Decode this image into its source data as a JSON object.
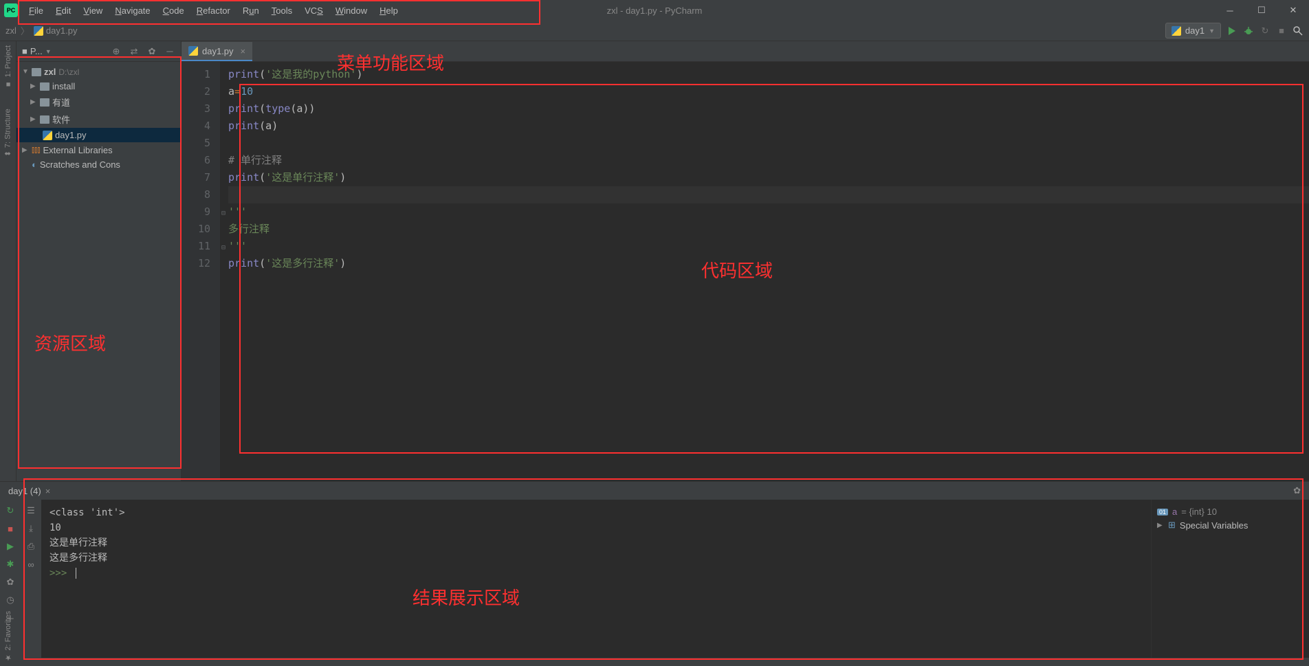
{
  "window": {
    "title": "zxl - day1.py - PyCharm",
    "app": "PC"
  },
  "menu": [
    "File",
    "Edit",
    "View",
    "Navigate",
    "Code",
    "Refactor",
    "Run",
    "Tools",
    "VCS",
    "Window",
    "Help"
  ],
  "menu_underline_index": [
    0,
    0,
    0,
    0,
    0,
    0,
    1,
    0,
    2,
    0,
    0
  ],
  "breadcrumb": {
    "root": "zxl",
    "file": "day1.py"
  },
  "run_config": {
    "name": "day1"
  },
  "sidebar": {
    "title": "P...",
    "root": {
      "name": "zxl",
      "path": "D:\\zxl"
    },
    "folders": [
      "install",
      "有道",
      "软件"
    ],
    "file": "day1.py",
    "external": "External Libraries",
    "scratches": "Scratches and Cons"
  },
  "tab": {
    "name": "day1.py"
  },
  "code": {
    "lines": [
      {
        "n": 1,
        "html": "<span class='builtin'>print</span>(<span class='str'>'这是我的python'</span>)"
      },
      {
        "n": 2,
        "html": "a<span class='kw'>=</span><span class='num'>10</span>"
      },
      {
        "n": 3,
        "html": "<span class='builtin'>print</span>(<span class='builtin'>type</span>(a))"
      },
      {
        "n": 4,
        "html": "<span class='builtin'>print</span>(a)"
      },
      {
        "n": 5,
        "html": ""
      },
      {
        "n": 6,
        "html": "<span class='cmt'># 单行注释</span>"
      },
      {
        "n": 7,
        "html": "<span class='builtin'>print</span>(<span class='str'>'这是单行注释'</span>)"
      },
      {
        "n": 8,
        "html": "",
        "current": true
      },
      {
        "n": 9,
        "html": "<span class='fold'>⊟</span><span class='str'>'''</span>"
      },
      {
        "n": 10,
        "html": "<span class='str'>多行注释</span>"
      },
      {
        "n": 11,
        "html": "<span class='fold'>⊟</span><span class='str'>'''</span>"
      },
      {
        "n": 12,
        "html": "<span class='builtin'>print</span>(<span class='str'>'这是多行注释'</span>)"
      }
    ]
  },
  "console": {
    "tab": "day1 (4)",
    "output": [
      "<class 'int'>",
      "10",
      "这是单行注释",
      "这是多行注释",
      "",
      ""
    ],
    "prompt": ">>>",
    "vars": {
      "a": {
        "badge": "01",
        "name": "a",
        "text": "= {int} 10"
      },
      "special": "Special Variables"
    }
  },
  "left_tabs": {
    "project": "1: Project",
    "structure": "7: Structure",
    "favorites": "2: Favorites"
  },
  "annotations": {
    "menu": "菜单功能区域",
    "sidebar": "资源区域",
    "code": "代码区域",
    "result": "结果展示区域"
  }
}
